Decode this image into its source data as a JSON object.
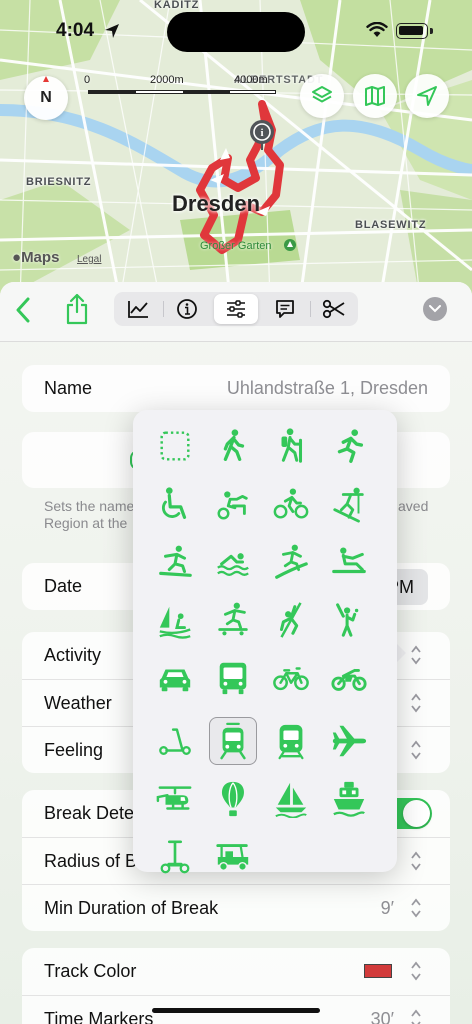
{
  "status_bar": {
    "time": "4:04"
  },
  "map": {
    "labels": [
      "KADITZ",
      "BRIESNITZ",
      "BLASEWITZ"
    ],
    "city": "Dresden",
    "garden": "Großer Garten",
    "scale": [
      "0",
      "2000m",
      "4000m"
    ],
    "maps_logo": "Maps",
    "legal": "Legal",
    "compass": "N",
    "partial_label": "ALBERTSTADT"
  },
  "toolbar": {
    "tabs": [
      "chart",
      "info",
      "settings",
      "comments",
      "scissors"
    ],
    "active_tab": "settings"
  },
  "form": {
    "name_label": "Name",
    "name_value": "Uhlandstraße 1, Dresden",
    "region_note_line1": "Sets the name",
    "region_note_line1_tail": "aved",
    "region_note_line2": "Region at the",
    "date_label": "Date",
    "date_value": "PM",
    "activity_label": "Activity",
    "weather_label": "Weather",
    "feeling_label": "Feeling",
    "break_label": "Break Dete",
    "radius_label": "Radius of B",
    "min_duration_label": "Min Duration of Break",
    "min_duration_value": "9′",
    "track_color_label": "Track Color",
    "time_markers_label": "Time Markers",
    "time_markers_value": "30′"
  },
  "popover": {
    "icons": [
      "none-dotted-square-icon",
      "walking-icon",
      "hiking-icon",
      "running-icon",
      "wheelchair-icon",
      "handcycle-icon",
      "cycling-icon",
      "skiing-icon",
      "snowboarding-icon",
      "swimming-icon",
      "surfing-icon",
      "rowing-icon",
      "sailing-icon",
      "skateboarding-icon",
      "climbing-icon",
      "cricket-icon",
      "car-icon",
      "bus-icon",
      "bicycle-icon",
      "motorcycle-icon",
      "scooter-icon",
      "tram-icon",
      "train-icon",
      "airplane-icon",
      "helicopter-icon",
      "balloon-icon",
      "sailboat-icon",
      "ferry-icon",
      "segway-icon",
      "golf-cart-icon"
    ],
    "selected": "tram-icon"
  },
  "colors": {
    "accent": "#34c759",
    "track": "#d23b3b",
    "route": "#e0373b"
  }
}
